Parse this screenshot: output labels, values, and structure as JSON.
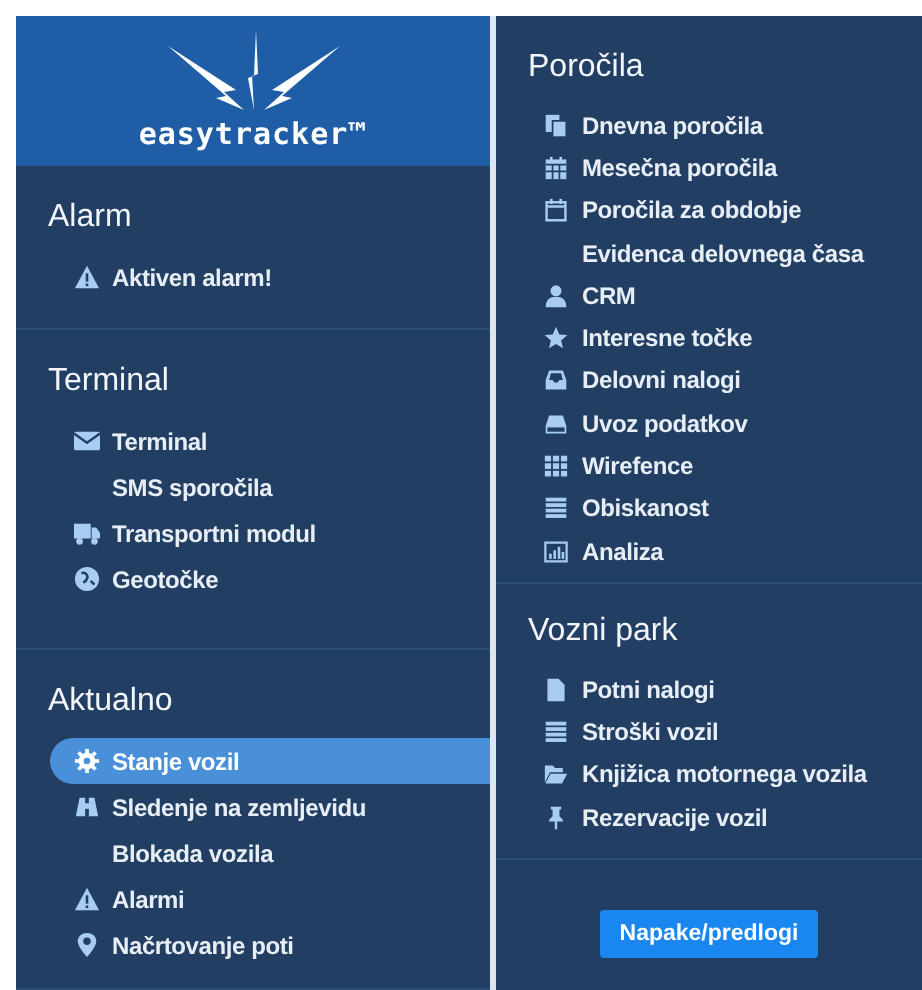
{
  "logo": "easytracker™",
  "left_sections": [
    {
      "title": "Alarm",
      "items": [
        {
          "label": "Aktiven alarm!",
          "selected": false
        }
      ]
    },
    {
      "title": "Terminal",
      "items": [
        {
          "label": "Terminal",
          "selected": false
        },
        {
          "label": "SMS sporočila",
          "selected": false
        },
        {
          "label": "Transportni modul",
          "selected": false
        },
        {
          "label": "Geotočke",
          "selected": false
        }
      ]
    },
    {
      "title": "Aktualno",
      "items": [
        {
          "label": "Stanje vozil",
          "selected": true
        },
        {
          "label": "Sledenje na zemljevidu",
          "selected": false
        },
        {
          "label": "Blokada vozila",
          "selected": false
        },
        {
          "label": "Alarmi",
          "selected": false
        },
        {
          "label": "Načrtovanje poti",
          "selected": false
        }
      ]
    }
  ],
  "right_sections": [
    {
      "title": "Poročila",
      "items": [
        {
          "label": "Dnevna poročila",
          "selected": false
        },
        {
          "label": "Mesečna poročila",
          "selected": false
        },
        {
          "label": "Poročila za obdobje",
          "selected": false
        },
        {
          "label": "Evidenca delovnega časa",
          "selected": false
        },
        {
          "label": "CRM",
          "selected": false
        },
        {
          "label": "Interesne točke",
          "selected": false
        },
        {
          "label": "Delovni nalogi",
          "selected": false
        },
        {
          "label": "Uvoz podatkov",
          "selected": false
        },
        {
          "label": "Wirefence",
          "selected": false
        },
        {
          "label": "Obiskanost",
          "selected": false
        },
        {
          "label": "Analiza",
          "selected": false
        }
      ]
    },
    {
      "title": "Vozni park",
      "items": [
        {
          "label": "Potni nalogi",
          "selected": false
        },
        {
          "label": "Stroški vozil",
          "selected": false
        },
        {
          "label": "Knjižica motornega vozila",
          "selected": false
        },
        {
          "label": "Rezervacije vozil",
          "selected": false
        }
      ]
    }
  ],
  "feedback_button": "Napake/predlogi"
}
